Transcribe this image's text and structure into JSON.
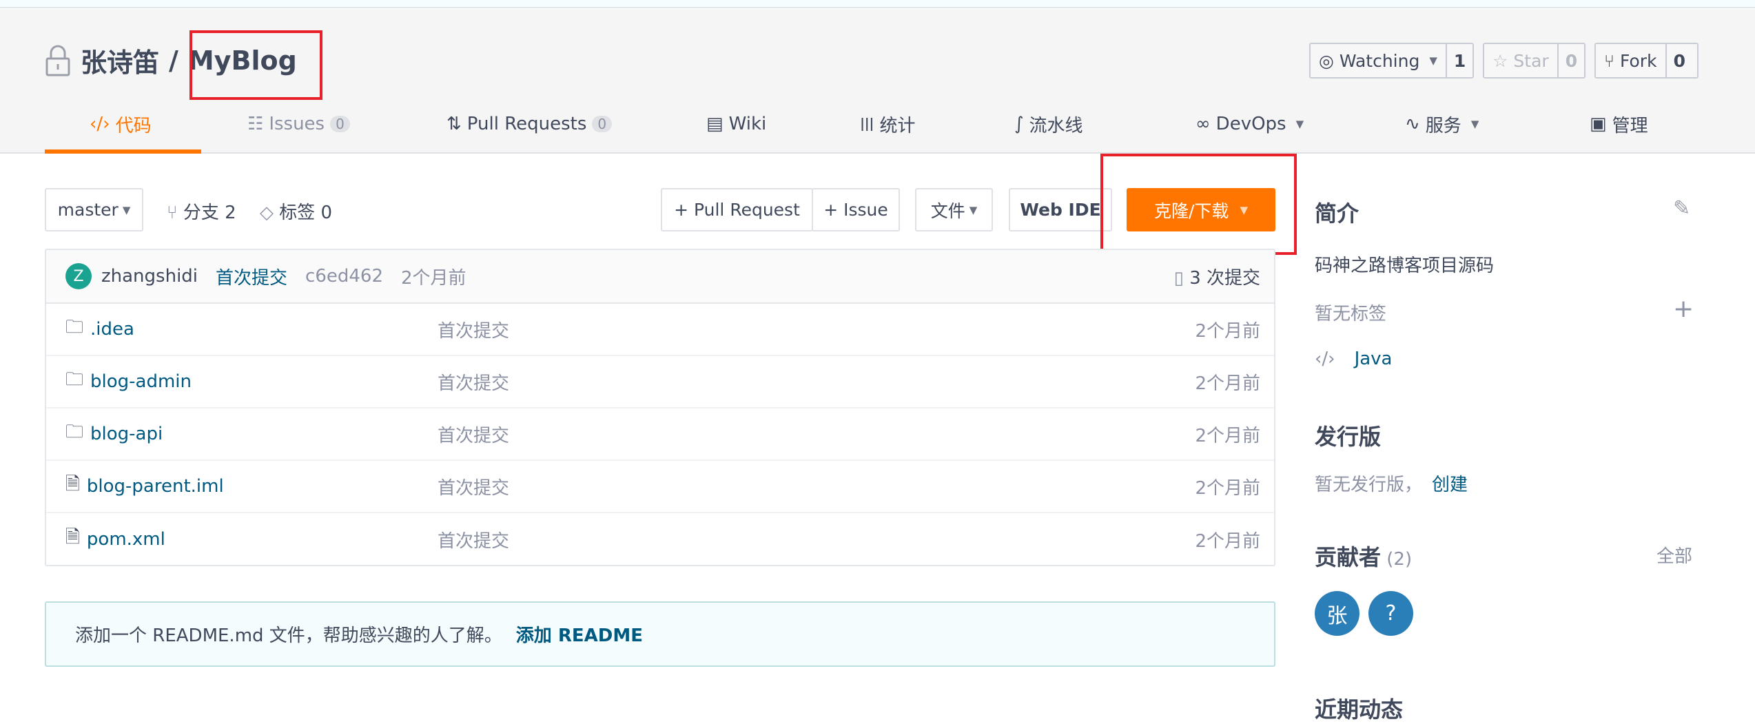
{
  "repo": {
    "owner": "张诗笛",
    "separator": "/",
    "name": "MyBlog"
  },
  "header_actions": {
    "watch": {
      "label": "Watching",
      "count": "1"
    },
    "star": {
      "label": "Star",
      "count": "0"
    },
    "fork": {
      "label": "Fork",
      "count": "0"
    }
  },
  "tabs": [
    {
      "label": "代码",
      "icon": "code-icon",
      "active": true
    },
    {
      "label": "Issues",
      "badge": "0",
      "icon": "issues-icon"
    },
    {
      "label": "Pull Requests",
      "badge": "0",
      "icon": "pull-request-icon"
    },
    {
      "label": "Wiki",
      "icon": "book-icon"
    },
    {
      "label": "统计",
      "icon": "bar-chart-icon"
    },
    {
      "label": "流水线",
      "icon": "pipeline-icon"
    },
    {
      "label": "DevOps",
      "icon": "infinity-icon"
    },
    {
      "label": "服务",
      "icon": "pulse-icon"
    },
    {
      "label": "管理",
      "icon": "settings-doc-icon"
    }
  ],
  "toolbar": {
    "branch": "master",
    "branches": "分支 2",
    "tags": "标签 0",
    "pull_request": "+ Pull Request",
    "issue": "+ Issue",
    "file": "文件",
    "web_ide": "Web IDE",
    "clone": "克隆/下载"
  },
  "commit": {
    "avatar": "Z",
    "author": "zhangshidi",
    "message": "首次提交",
    "hash": "c6ed462",
    "time": "2个月前",
    "count": "3 次提交"
  },
  "files": [
    {
      "name": ".idea",
      "type": "folder",
      "message": "首次提交",
      "time": "2个月前"
    },
    {
      "name": "blog-admin",
      "type": "folder",
      "message": "首次提交",
      "time": "2个月前"
    },
    {
      "name": "blog-api",
      "type": "folder",
      "message": "首次提交",
      "time": "2个月前"
    },
    {
      "name": "blog-parent.iml",
      "type": "file",
      "message": "首次提交",
      "time": "2个月前"
    },
    {
      "name": "pom.xml",
      "type": "file",
      "message": "首次提交",
      "time": "2个月前"
    }
  ],
  "readme": {
    "text": "添加一个 README.md 文件，帮助感兴趣的人了解。",
    "link": "添加 README"
  },
  "sidebar": {
    "intro_title": "简介",
    "description": "码神之路博客项目源码",
    "no_tags": "暂无标签",
    "language": "Java",
    "release_title": "发行版",
    "no_release": "暂无发行版，",
    "create": "创建",
    "contributors_title": "贡献者",
    "contributors_count": "(2)",
    "all": "全部",
    "contributors": [
      "张",
      "?"
    ],
    "activity_title": "近期动态"
  },
  "colors": {
    "accent": "#ff7500",
    "link": "#005980",
    "highlight_box": "#e8202a"
  }
}
